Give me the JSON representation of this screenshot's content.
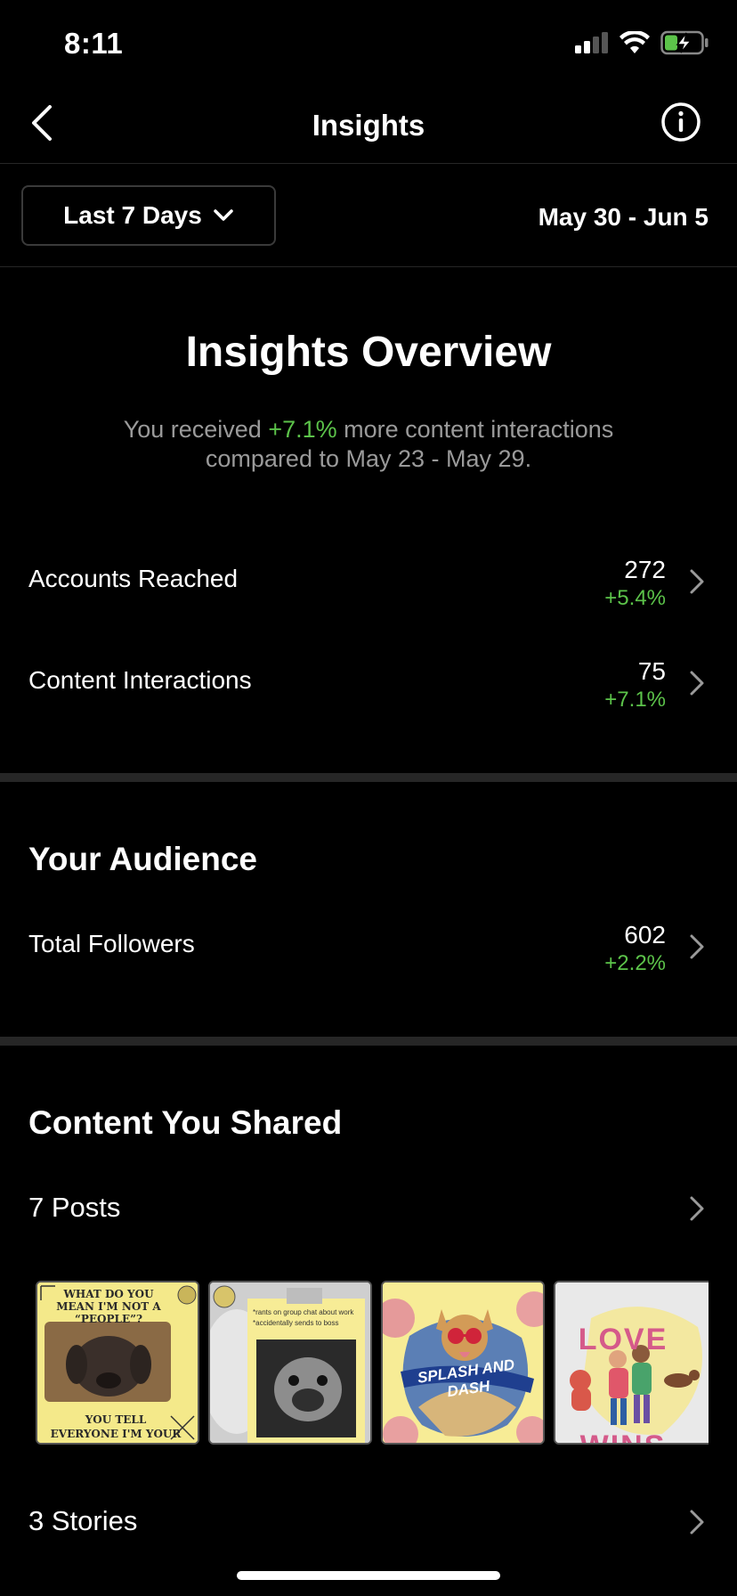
{
  "status_bar": {
    "time": "8:11"
  },
  "nav": {
    "title": "Insights"
  },
  "filter": {
    "range_label": "Last 7 Days",
    "date_range": "May 30 - Jun 5"
  },
  "overview": {
    "title": "Insights Overview",
    "summary_prefix": "You received ",
    "summary_highlight": "+7.1%",
    "summary_suffix": " more content interactions compared to May 23 - May 29."
  },
  "metrics": [
    {
      "label": "Accounts Reached",
      "value": "272",
      "change": "+5.4%"
    },
    {
      "label": "Content Interactions",
      "value": "75",
      "change": "+7.1%"
    }
  ],
  "audience": {
    "title": "Your Audience",
    "total_followers_label": "Total Followers",
    "total_followers_value": "602",
    "total_followers_change": "+2.2%"
  },
  "content": {
    "title": "Content You Shared",
    "posts_label": "7 Posts",
    "stories_label": "3 Stories",
    "thumbnails": [
      {
        "top_text": "WHAT DO YOU MEAN I'M NOT A “PEOPLE”?",
        "bottom_text": "YOU TELL EVERYONE I'M YOUR BABY!"
      },
      {
        "caption": "*rants on group chat about work *accidentally sends to boss"
      },
      {
        "text": "SPLASH AND DASH"
      },
      {
        "text": "LOVE WINS"
      }
    ]
  },
  "colors": {
    "positive": "#5cc34a",
    "background": "#000000",
    "divider": "#262626"
  }
}
